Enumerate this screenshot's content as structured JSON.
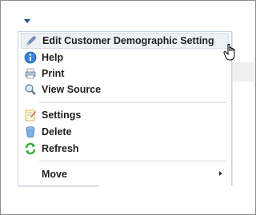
{
  "menu": {
    "items": [
      {
        "label": "Edit Customer Demographic Setting",
        "icon": "pencil-icon"
      },
      {
        "label": "Help",
        "icon": "help-icon"
      },
      {
        "label": "Print",
        "icon": "print-icon"
      },
      {
        "label": "View Source",
        "icon": "magnifier-icon"
      },
      {
        "label": "Settings",
        "icon": "settings-icon"
      },
      {
        "label": "Delete",
        "icon": "trash-icon"
      },
      {
        "label": "Refresh",
        "icon": "refresh-icon"
      },
      {
        "label": "Move",
        "icon": "none"
      }
    ]
  },
  "colors": {
    "hover_bg": "#ecf1f6",
    "menu_border": "#c6d3e0",
    "dropdown_arrow": "#1f4e8c"
  }
}
